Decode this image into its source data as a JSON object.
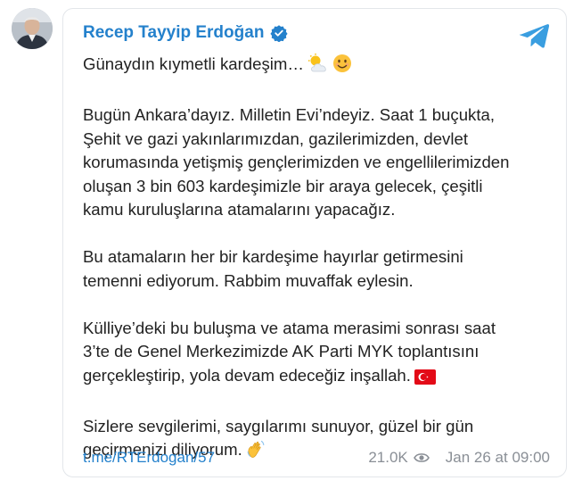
{
  "post": {
    "author": "Recep Tayyip Erdoğan",
    "paragraphs": [
      {
        "lines": [
          "Günaydın kıymetli kardeşim…"
        ],
        "trailing_emoji": [
          "sun-behind-cloud-emoji",
          "smiling-face-emoji"
        ]
      },
      {
        "lines": [
          "Bugün Ankara’dayız. Milletin Evi’ndeyiz. Saat 1 buçukta,",
          "Şehit ve gazi yakınlarımızdan, gazilerimizden, devlet",
          "korumasında yetişmiş gençlerimizden ve engellilerimizden",
          "oluşan 3 bin 603 kardeşimizle bir araya gelecek, çeşitli",
          "kamu kuruluşlarına atamalarını yapacağız."
        ]
      },
      {
        "lines": [
          "Bu atamaların her bir kardeşime hayırlar getirmesini",
          "temenni ediyorum. Rabbim muvaffak eylesin."
        ]
      },
      {
        "lines": [
          "Külliye’deki bu buluşma ve atama merasimi sonrası saat",
          "3’te de Genel Merkezimizde AK Parti MYK toplantısını",
          "gerçekleştirip, yola devam edeceğiz inşallah."
        ],
        "trailing_emoji": [
          "turkish-flag-emoji"
        ]
      },
      {
        "lines": [
          "Sizlere sevgilerimi, saygılarımı sunuyor, güzel bir gün",
          "geçirmenizi diliyorum."
        ],
        "trailing_emoji": [
          "waving-hand-emoji"
        ]
      }
    ],
    "link": "t.me/RTErdogan/57",
    "views": "21.0K",
    "date": "Jan 26 at 09:00"
  },
  "colors": {
    "author": "#2481cc",
    "link": "#2481cc",
    "meta": "#8a8f96",
    "text": "#222222",
    "telegram": "#3a9ee0",
    "card_border": "#e3e6ea"
  }
}
